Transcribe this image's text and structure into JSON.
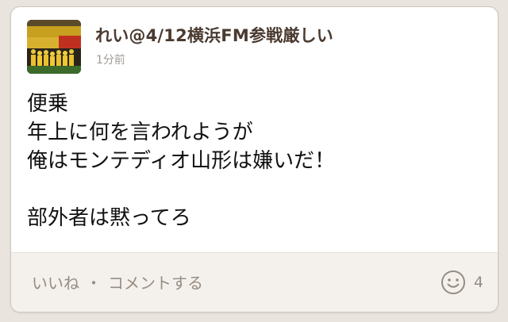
{
  "post": {
    "user_name": "れい@4/12横浜FM参戦厳しい",
    "timestamp": "1分前",
    "body_lines": [
      "便乗",
      "年上に何を言われようが",
      "俺はモンテディオ山形は嫌いだ！",
      "",
      "部外者は黙ってろ"
    ]
  },
  "footer": {
    "like_label": "いいね",
    "separator": "・",
    "comment_label": "コメントする",
    "like_count": "4",
    "smile_icon": "smile-icon"
  },
  "colors": {
    "page_bg": "#e9e4dd",
    "card_bg": "#ffffff",
    "footer_bg": "#f4f1ed",
    "name_color": "#4a3a30",
    "muted_text": "#968c82"
  }
}
